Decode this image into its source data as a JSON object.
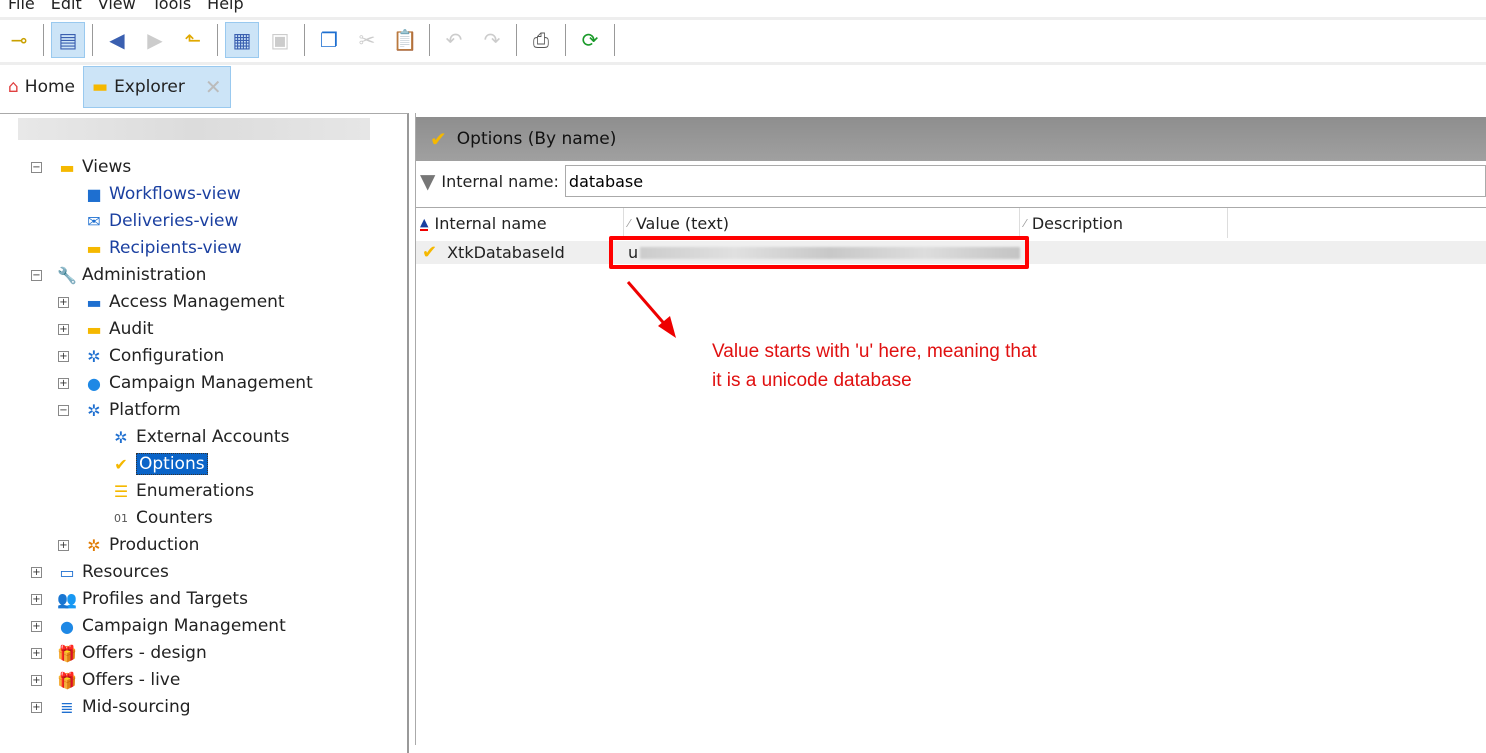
{
  "menu": [
    "File",
    "Edit",
    "View",
    "Tools",
    "Help"
  ],
  "tabs": {
    "home": "Home",
    "explorer": "Explorer"
  },
  "tree": [
    {
      "label": "Views",
      "level": 1,
      "exp": "−",
      "icon": "▬",
      "color": "#f5b800",
      "link": false
    },
    {
      "label": "Workflows-view",
      "level": 2,
      "exp": "",
      "icon": "■",
      "color": "#1e6fd0",
      "link": true
    },
    {
      "label": "Deliveries-view",
      "level": 2,
      "exp": "",
      "icon": "✉",
      "color": "#1e6fd0",
      "link": true
    },
    {
      "label": "Recipients-view",
      "level": 2,
      "exp": "",
      "icon": "▬",
      "color": "#f5b800",
      "link": true
    },
    {
      "label": "Administration",
      "level": 1,
      "exp": "−",
      "icon": "🔧",
      "color": "#e07a00",
      "link": false
    },
    {
      "label": "Access Management",
      "level": 2,
      "exp": "+",
      "icon": "▬",
      "color": "#1e6fd0",
      "link": false
    },
    {
      "label": "Audit",
      "level": 2,
      "exp": "+",
      "icon": "▬",
      "color": "#f5b800",
      "link": false
    },
    {
      "label": "Configuration",
      "level": 2,
      "exp": "+",
      "icon": "✲",
      "color": "#1e6fd0",
      "link": false
    },
    {
      "label": "Campaign Management",
      "level": 2,
      "exp": "+",
      "icon": "●",
      "color": "#1e88e5",
      "link": false
    },
    {
      "label": "Platform",
      "level": 2,
      "exp": "−",
      "icon": "✲",
      "color": "#1e6fd0",
      "link": false
    },
    {
      "label": "External Accounts",
      "level": 3,
      "exp": "",
      "icon": "✲",
      "color": "#1e6fd0",
      "link": false
    },
    {
      "label": "Options",
      "level": 3,
      "exp": "",
      "icon": "✔",
      "color": "#f5b800",
      "link": false,
      "selected": true
    },
    {
      "label": "Enumerations",
      "level": 3,
      "exp": "",
      "icon": "☰",
      "color": "#f5b800",
      "link": false
    },
    {
      "label": "Counters",
      "level": 3,
      "exp": "",
      "icon": "01",
      "color": "#555",
      "link": false
    },
    {
      "label": "Production",
      "level": 2,
      "exp": "+",
      "icon": "✲",
      "color": "#e07a00",
      "link": false
    },
    {
      "label": "Resources",
      "level": 1,
      "exp": "+",
      "icon": "▭",
      "color": "#1e6fd0",
      "link": false
    },
    {
      "label": "Profiles and Targets",
      "level": 1,
      "exp": "+",
      "icon": "👥",
      "color": "#1e6fd0",
      "link": false
    },
    {
      "label": "Campaign Management",
      "level": 1,
      "exp": "+",
      "icon": "●",
      "color": "#1e88e5",
      "link": false
    },
    {
      "label": "Offers - design",
      "level": 1,
      "exp": "+",
      "icon": "🎁",
      "color": "#f5b800",
      "link": false
    },
    {
      "label": "Offers - live",
      "level": 1,
      "exp": "+",
      "icon": "🎁",
      "color": "#f5b800",
      "link": false
    },
    {
      "label": "Mid-sourcing",
      "level": 1,
      "exp": "+",
      "icon": "≣",
      "color": "#1e6fd0",
      "link": false
    }
  ],
  "panel": {
    "title": "Options (By name)",
    "filter_label": "Internal name:",
    "filter_value": "database"
  },
  "table": {
    "columns": [
      "Internal name",
      "Value (text)",
      "Description"
    ],
    "rows": [
      {
        "name": "XtkDatabaseId",
        "value_prefix": "u"
      }
    ]
  },
  "annotation": {
    "line1": "Value starts with 'u' here, meaning that",
    "line2": "it is a unicode database"
  }
}
